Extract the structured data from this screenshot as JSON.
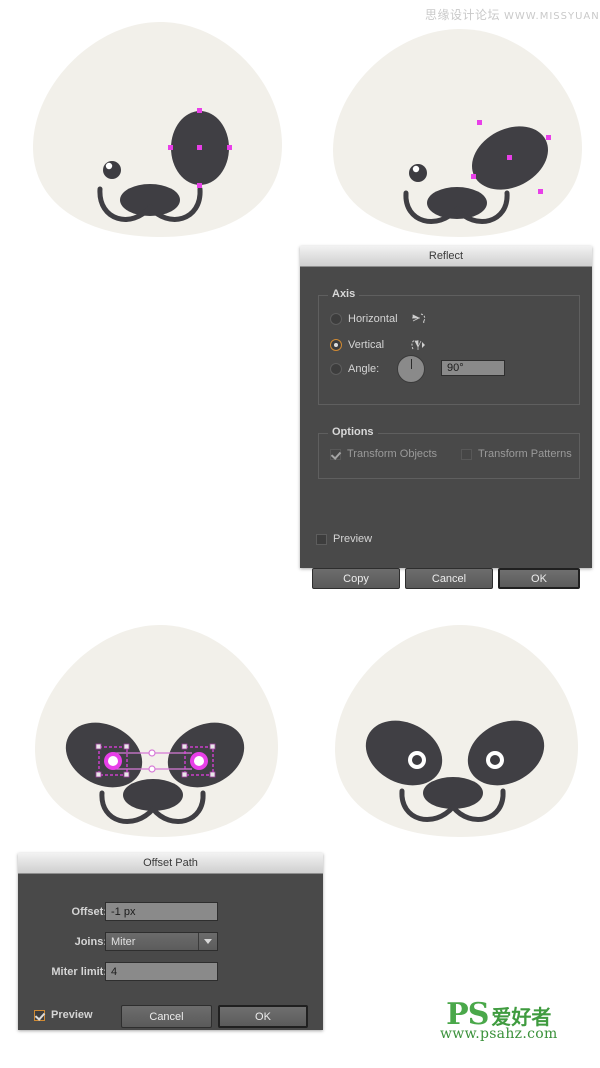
{
  "watermarks": {
    "top_cn": "思缘设计论坛",
    "top_url": "WWW.MISSYUAN.COM",
    "bottom_logo": "PS",
    "bottom_cn": "爱好者",
    "bottom_url": "www.psahz.com"
  },
  "colors": {
    "head": "#f2f0ea",
    "patch": "#403f44",
    "nose": "#3f3e43",
    "mouth": "#3f3e43",
    "eye_dot": "#3d3c41",
    "eye_highlight": "#ffffff",
    "anchor": "#e83fe8",
    "selection": "#d77ad7",
    "dialog_bg": "#494949",
    "accent_orange": "#d08a33"
  },
  "reflect_dialog": {
    "title": "Reflect",
    "axis_group_label": "Axis",
    "options_group_label": "Options",
    "axis_options": [
      {
        "label": "Horizontal",
        "selected": false,
        "icon": "reflect-horizontal-icon"
      },
      {
        "label": "Vertical",
        "selected": true,
        "icon": "reflect-vertical-icon"
      },
      {
        "label": "Angle:",
        "selected": false,
        "icon": "angle-dial-icon"
      }
    ],
    "angle_value": "90°",
    "options": [
      {
        "label": "Transform Objects",
        "checked": true,
        "disabled": true
      },
      {
        "label": "Transform Patterns",
        "checked": false,
        "disabled": true
      }
    ],
    "preview": {
      "label": "Preview",
      "checked": false
    },
    "buttons": [
      {
        "label": "Copy",
        "default": false
      },
      {
        "label": "Cancel",
        "default": false
      },
      {
        "label": "OK",
        "default": true
      }
    ]
  },
  "offset_path_dialog": {
    "title": "Offset Path",
    "fields": [
      {
        "label": "Offset:",
        "value": "-1 px",
        "type": "text"
      },
      {
        "label": "Joins:",
        "value": "Miter",
        "type": "select"
      },
      {
        "label": "Miter limit:",
        "value": "4",
        "type": "text"
      }
    ],
    "preview": {
      "label": "Preview",
      "checked": true
    },
    "buttons": [
      {
        "label": "Cancel",
        "default": false
      },
      {
        "label": "OK",
        "default": true
      }
    ]
  },
  "artboards": [
    {
      "name": "panda-step-1",
      "caption": "Panda head with single right eye patch selected (ellipse, anchor points shown)",
      "eye_patches": 1,
      "patch_rotation_deg": 0,
      "selection_visible": true
    },
    {
      "name": "panda-step-2",
      "caption": "Panda head with right eye patch rotated, anchor points shown",
      "eye_patches": 1,
      "patch_rotation_deg": -27,
      "selection_visible": true
    },
    {
      "name": "panda-step-3",
      "caption": "Panda head with both mirrored eye patches and two small pupils selected",
      "eye_patches": 2,
      "patch_rotation_deg": 27,
      "selection_visible": true
    },
    {
      "name": "panda-step-4",
      "caption": "Finished panda head with both eye patches and white ringed pupils",
      "eye_patches": 2,
      "patch_rotation_deg": 27,
      "selection_visible": false
    }
  ]
}
